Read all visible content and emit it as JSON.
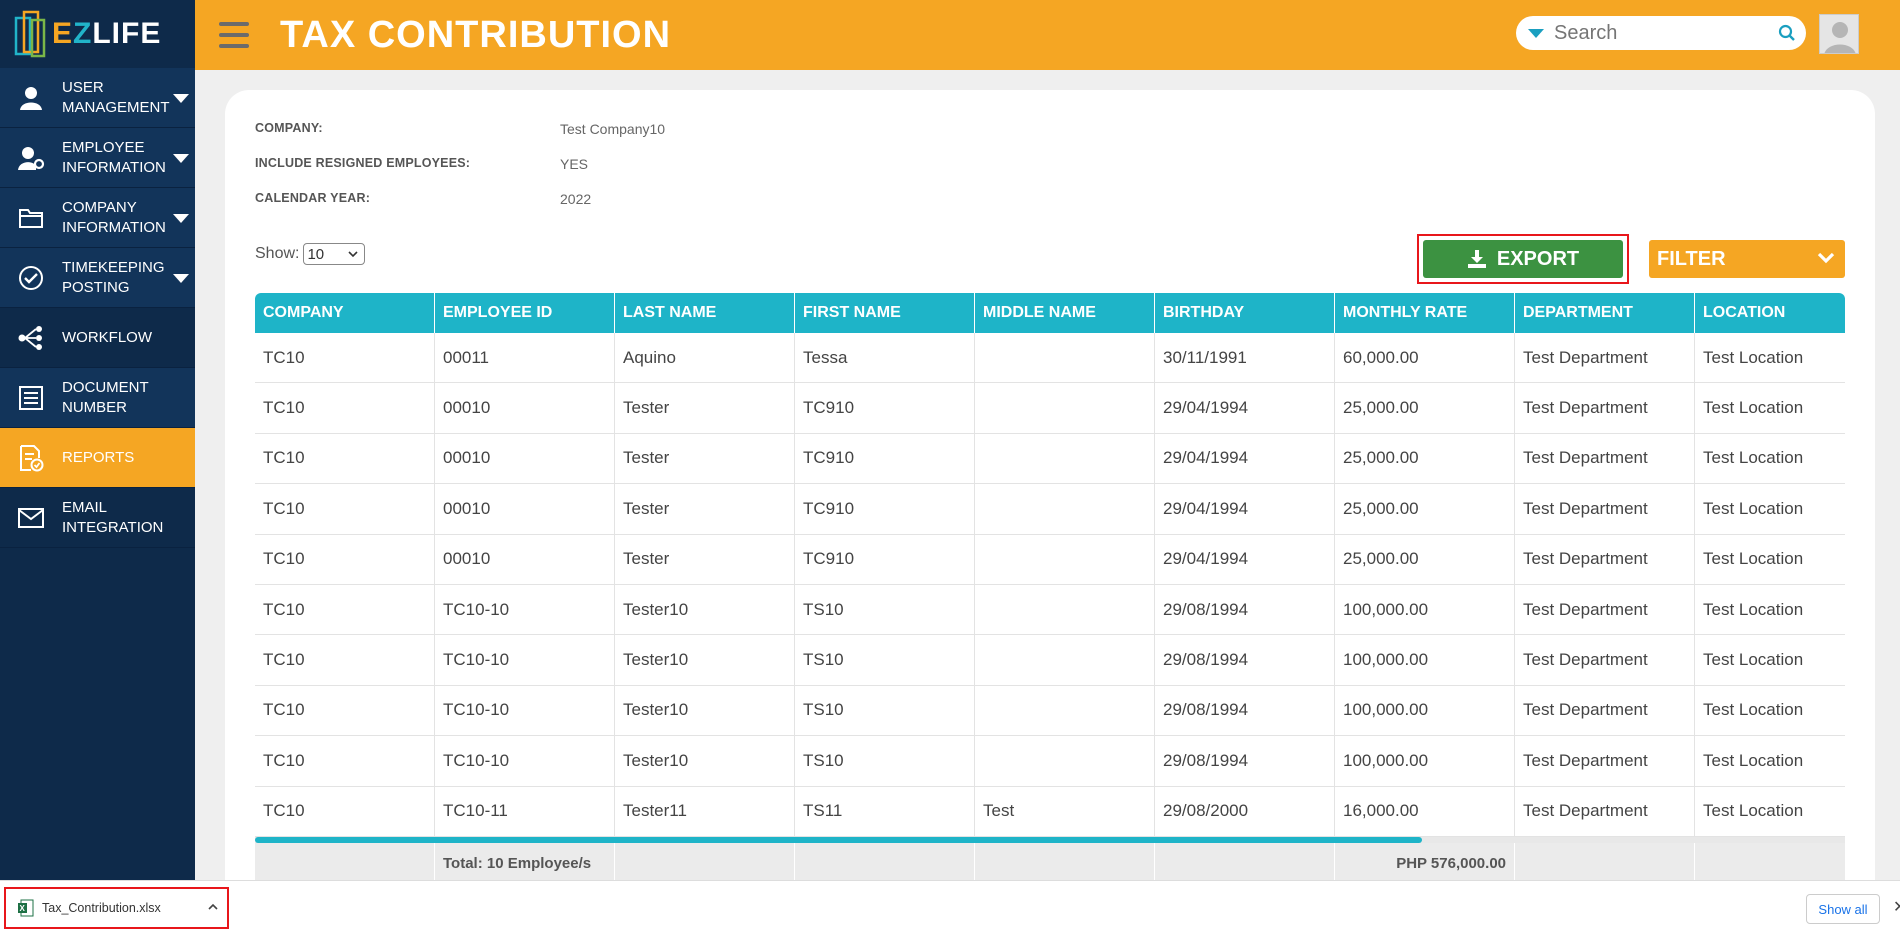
{
  "app": {
    "logo_text_e": "E",
    "logo_text_z": "Z",
    "logo_text_rest": "LIFE"
  },
  "sidebar": {
    "items": [
      {
        "label": "User Management",
        "icon": "user-icon",
        "caret": true
      },
      {
        "label": "Employee Information",
        "icon": "user-gear-icon",
        "caret": true
      },
      {
        "label": "Company Information",
        "icon": "folder-icon",
        "caret": true
      },
      {
        "label": "Timekeeping Posting",
        "icon": "check-circle-icon",
        "caret": true
      },
      {
        "label": "Workflow",
        "icon": "workflow-icon",
        "caret": false
      },
      {
        "label": "Document Number",
        "icon": "document-list-icon",
        "caret": false
      },
      {
        "label": "Reports",
        "icon": "report-icon",
        "caret": false,
        "active": true
      },
      {
        "label": "Email Integration",
        "icon": "mail-icon",
        "caret": false
      }
    ]
  },
  "header": {
    "title": "TAX CONTRIBUTION",
    "search_placeholder": "Search"
  },
  "meta": {
    "company_label": "COMPANY:",
    "company_value": "Test Company10",
    "resigned_label": "INCLUDE RESIGNED EMPLOYEES:",
    "resigned_value": "YES",
    "year_label": "CALENDAR YEAR:",
    "year_value": "2022"
  },
  "controls": {
    "show_label": "Show:",
    "show_value": "10",
    "export_label": "EXPORT",
    "filter_label": "FILTER"
  },
  "table": {
    "columns": [
      "COMPANY",
      "EMPLOYEE ID",
      "LAST NAME",
      "FIRST NAME",
      "MIDDLE NAME",
      "BIRTHDAY",
      "MONTHLY RATE",
      "DEPARTMENT",
      "LOCATION"
    ],
    "rows": [
      [
        "TC10",
        "00011",
        "Aquino",
        "Tessa",
        "",
        "30/11/1991",
        "60,000.00",
        "Test Department",
        "Test Location"
      ],
      [
        "TC10",
        "00010",
        "Tester",
        "TC910",
        "",
        "29/04/1994",
        "25,000.00",
        "Test Department",
        "Test Location"
      ],
      [
        "TC10",
        "00010",
        "Tester",
        "TC910",
        "",
        "29/04/1994",
        "25,000.00",
        "Test Department",
        "Test Location"
      ],
      [
        "TC10",
        "00010",
        "Tester",
        "TC910",
        "",
        "29/04/1994",
        "25,000.00",
        "Test Department",
        "Test Location"
      ],
      [
        "TC10",
        "00010",
        "Tester",
        "TC910",
        "",
        "29/04/1994",
        "25,000.00",
        "Test Department",
        "Test Location"
      ],
      [
        "TC10",
        "TC10-10",
        "Tester10",
        "TS10",
        "",
        "29/08/1994",
        "100,000.00",
        "Test Department",
        "Test Location"
      ],
      [
        "TC10",
        "TC10-10",
        "Tester10",
        "TS10",
        "",
        "29/08/1994",
        "100,000.00",
        "Test Department",
        "Test Location"
      ],
      [
        "TC10",
        "TC10-10",
        "Tester10",
        "TS10",
        "",
        "29/08/1994",
        "100,000.00",
        "Test Department",
        "Test Location"
      ],
      [
        "TC10",
        "TC10-10",
        "Tester10",
        "TS10",
        "",
        "29/08/1994",
        "100,000.00",
        "Test Department",
        "Test Location"
      ],
      [
        "TC10",
        "TC10-11",
        "Tester11",
        "TS11",
        "Test",
        "29/08/2000",
        "16,000.00",
        "Test Department",
        "Test Location"
      ]
    ],
    "footer": {
      "total_employees": "Total: 10 Employee/s",
      "total_rate": "PHP 576,000.00"
    }
  },
  "download": {
    "file_name": "Tax_Contribution.xlsx",
    "show_all": "Show all",
    "close": "✕"
  },
  "colors": {
    "orange": "#f5a623",
    "navy": "#0e2a4a",
    "teal": "#1eb4c8",
    "green": "#3c9241",
    "red": "#e8161b"
  }
}
